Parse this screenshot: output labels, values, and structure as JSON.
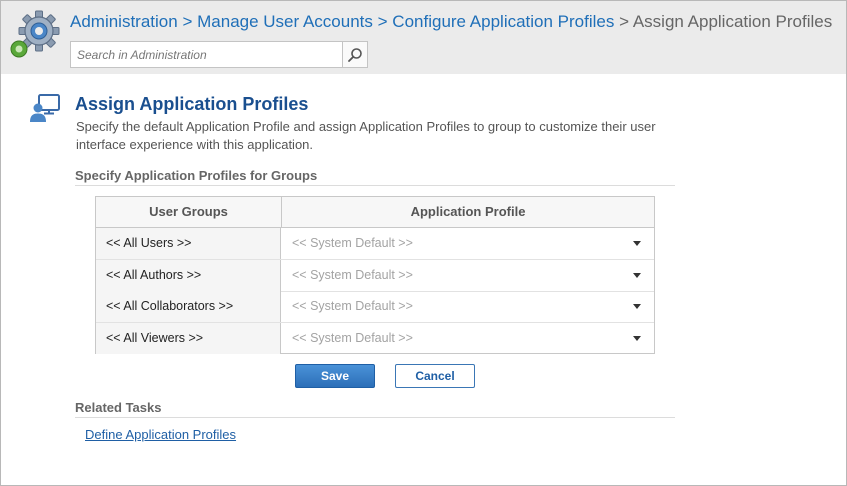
{
  "header": {
    "breadcrumb": [
      {
        "label": "Administration",
        "link": true
      },
      {
        "label": "Manage User Accounts",
        "link": true
      },
      {
        "label": "Configure Application Profiles",
        "link": true
      },
      {
        "label": "Assign Application Profiles",
        "link": false
      }
    ],
    "separator": ">",
    "search": {
      "placeholder": "Search in Administration",
      "value": ""
    }
  },
  "page": {
    "title": "Assign Application Profiles",
    "description": "Specify the default Application Profile and assign Application Profiles to group to customize their user interface experience with this application."
  },
  "groups_section": {
    "title": "Specify Application Profiles for Groups",
    "columns": [
      "User Groups",
      "Application Profile"
    ],
    "rows": [
      {
        "group": "<< All Users >>",
        "profile": "<< System Default >>"
      },
      {
        "group": "<< All Authors >>",
        "profile": "<< System Default >>"
      },
      {
        "group": "<< All Collaborators >>",
        "profile": "<< System Default >>"
      },
      {
        "group": "<< All Viewers >>",
        "profile": "<< System Default >>"
      }
    ]
  },
  "actions": {
    "save": "Save",
    "cancel": "Cancel"
  },
  "related": {
    "title": "Related Tasks",
    "links": [
      "Define Application Profiles"
    ]
  },
  "icons": {
    "app": "gear-icon",
    "page": "user-monitor-icon",
    "search": "search-icon",
    "dropdown": "chevron-down-icon"
  },
  "colors": {
    "link": "#1f6fb8",
    "title": "#1a4f8f",
    "primary_button": "#2c6fb8",
    "header_bg": "#ebebeb"
  }
}
